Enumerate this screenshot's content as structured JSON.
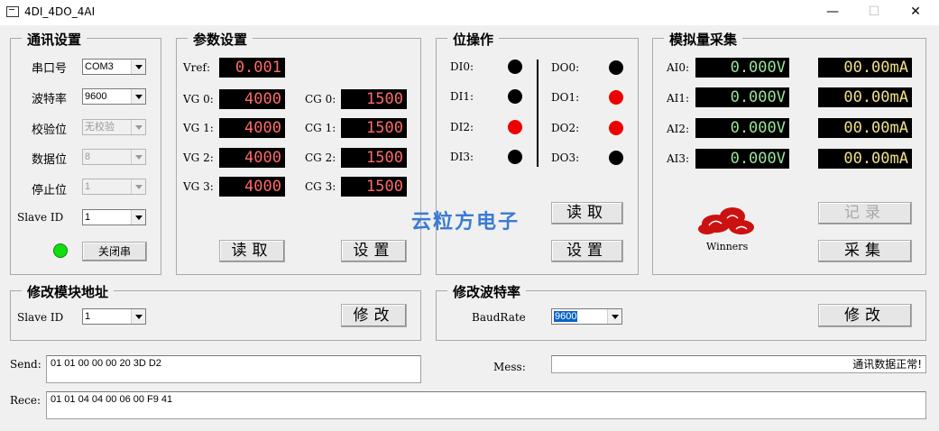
{
  "window": {
    "title": "4DI_4DO_4AI",
    "minimize": "—",
    "maximize": "☐",
    "close": "✕"
  },
  "comm": {
    "title": "通讯设置",
    "port_label": "串口号",
    "port_value": "COM3",
    "baud_label": "波特率",
    "baud_value": "9600",
    "parity_label": "校验位",
    "parity_value": "无校验",
    "databits_label": "数据位",
    "databits_value": "8",
    "stopbits_label": "停止位",
    "stopbits_value": "1",
    "slave_label": "Slave ID",
    "slave_value": "1",
    "close_port_button": "关闭串"
  },
  "params": {
    "title": "参数设置",
    "vref_label": "Vref:",
    "vref_value": "0.001",
    "vg": [
      {
        "label": "VG 0:",
        "value": "4000"
      },
      {
        "label": "VG 1:",
        "value": "4000"
      },
      {
        "label": "VG 2:",
        "value": "4000"
      },
      {
        "label": "VG 3:",
        "value": "4000"
      }
    ],
    "cg": [
      {
        "label": "CG 0:",
        "value": "1500"
      },
      {
        "label": "CG 1:",
        "value": "1500"
      },
      {
        "label": "CG 2:",
        "value": "1500"
      },
      {
        "label": "CG 3:",
        "value": "1500"
      }
    ],
    "read_button": "读取",
    "set_button": "设置"
  },
  "bits": {
    "title": "位操作",
    "di": [
      {
        "label": "DI0:",
        "state": "off"
      },
      {
        "label": "DI1:",
        "state": "off"
      },
      {
        "label": "DI2:",
        "state": "on"
      },
      {
        "label": "DI3:",
        "state": "off"
      }
    ],
    "do": [
      {
        "label": "DO0:",
        "state": "off"
      },
      {
        "label": "DO1:",
        "state": "on"
      },
      {
        "label": "DO2:",
        "state": "on"
      },
      {
        "label": "DO3:",
        "state": "off"
      }
    ],
    "read_button": "读取",
    "set_button": "设置"
  },
  "analog": {
    "title": "模拟量采集",
    "channels": [
      {
        "label": "AI0:",
        "voltage": "0.000V",
        "current": "00.00mA"
      },
      {
        "label": "AI1:",
        "voltage": "0.000V",
        "current": "00.00mA"
      },
      {
        "label": "AI2:",
        "voltage": "0.000V",
        "current": "00.00mA"
      },
      {
        "label": "AI3:",
        "voltage": "0.000V",
        "current": "00.00mA"
      }
    ],
    "logo_text": "Winners",
    "record_button": "记录",
    "collect_button": "采集"
  },
  "watermark": "云粒方电子",
  "addr": {
    "title": "修改模块地址",
    "slave_label": "Slave ID",
    "slave_value": "1",
    "modify_button": "修改"
  },
  "baudrate": {
    "title": "修改波特率",
    "label": "BaudRate",
    "value": "9600",
    "modify_button": "修改"
  },
  "send": {
    "label": "Send:",
    "value": "01 01 00 00 00 20 3D D2"
  },
  "mess": {
    "label": "Mess:",
    "value": "通讯数据正常!"
  },
  "rece": {
    "label": "Rece:",
    "value": "01 01 04 04 00 06 00 F9 41"
  },
  "colors": {
    "led_on": "#ee0000",
    "led_off": "#000000",
    "status_led": "#11dd11",
    "digit_red": "#ff6a6a",
    "digit_green": "#9be29b",
    "digit_yellow": "#f0e08a",
    "watermark": "#3a7bd5"
  }
}
